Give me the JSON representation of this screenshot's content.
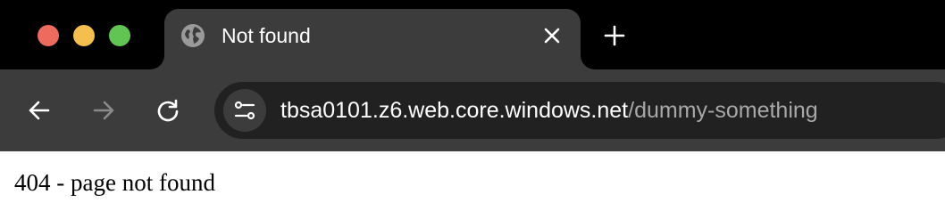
{
  "window": {
    "controls": [
      "close",
      "minimize",
      "zoom"
    ],
    "colors": {
      "close": "#ec6a5e",
      "minimize": "#f4bf4f",
      "zoom": "#61c554"
    }
  },
  "tab": {
    "title": "Not found",
    "favicon": "globe-icon",
    "close_icon": "close-icon"
  },
  "new_tab_icon": "plus-icon",
  "toolbar": {
    "back_icon": "arrow-left-icon",
    "forward_icon": "arrow-right-icon",
    "reload_icon": "reload-icon",
    "site_info_icon": "tune-icon"
  },
  "address_bar": {
    "host": "tbsa0101.z6.web.core.windows.net",
    "path": "/dummy-something"
  },
  "page": {
    "text": "404 - page not found"
  }
}
